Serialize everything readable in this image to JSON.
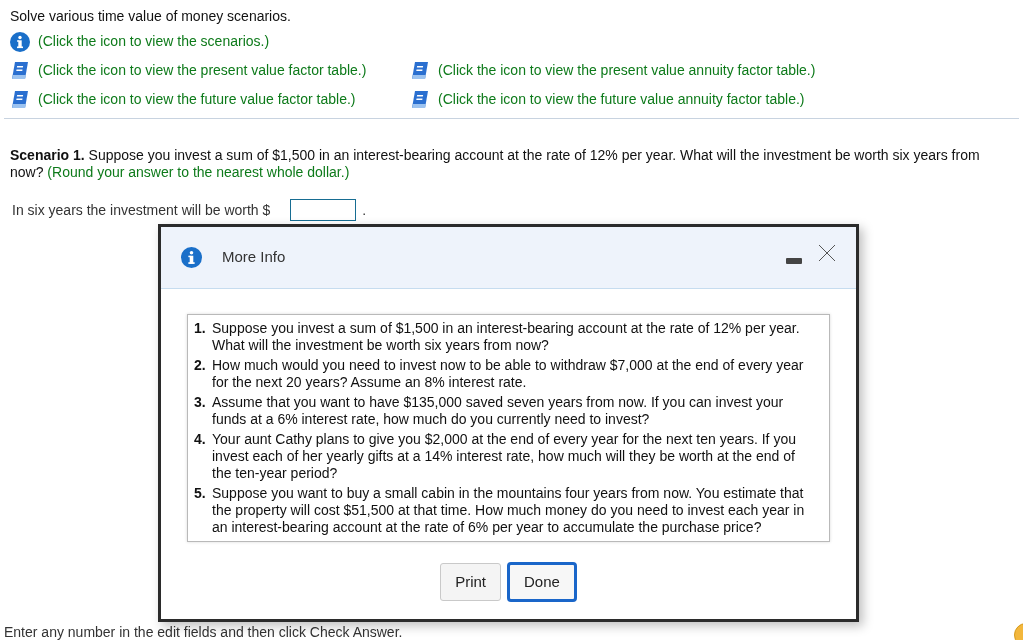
{
  "instructions": "Solve various time value of money scenarios.",
  "links": [
    {
      "kind": "info",
      "text": "(Click the icon to view the scenarios.)"
    },
    {
      "kind": "book",
      "text": "(Click the icon to view the present value factor table.)"
    },
    {
      "kind": "book",
      "text": "(Click the icon to view the present value annuity factor table.)"
    },
    {
      "kind": "book",
      "text": "(Click the icon to view the future value factor table.)"
    },
    {
      "kind": "book",
      "text": "(Click the icon to view the future value annuity factor table.)"
    }
  ],
  "scenario": {
    "label": "Scenario 1.",
    "text": "Suppose you invest a sum of $1,500 in an interest-bearing account at the rate of 12% per year. What will the investment be worth six years from now?",
    "hint": "(Round your answer to the nearest whole dollar.)"
  },
  "answer": {
    "prefix": "In six years the investment will be worth $",
    "suffix": "."
  },
  "footer": "Enter any number in the edit fields and then click Check Answer.",
  "dialog": {
    "title": "More Info",
    "items": [
      {
        "number": "1.",
        "text": "Suppose you invest a sum of $1,500 in an interest-bearing account at the rate of 12% per year. What will the investment be worth six years from now?"
      },
      {
        "number": "2.",
        "text": "How much would you need to invest now to be able to withdraw $7,000 at the end of every year for the next 20 years? Assume an 8% interest rate."
      },
      {
        "number": "3.",
        "text": "Assume that you want to have $135,000 saved seven years from now. If you can invest your funds at a 6% interest rate, how much do you currently need to invest?"
      },
      {
        "number": "4.",
        "text": "Your aunt Cathy plans to give you $2,000 at the end of every year for the next ten years. If you invest each of her yearly gifts at a 14% interest rate, how much will they be worth at the end of the ten-year period?"
      },
      {
        "number": "5.",
        "text": "Suppose you want to buy a small cabin in the mountains four years from now. You estimate that the property will cost $51,500 at that time. How much money do you need to invest each year in an interest-bearing account at the rate of 6% per year to accumulate the purchase price?"
      }
    ],
    "buttons": [
      {
        "label": "Print",
        "selected": false
      },
      {
        "label": "Done",
        "selected": true
      }
    ]
  }
}
